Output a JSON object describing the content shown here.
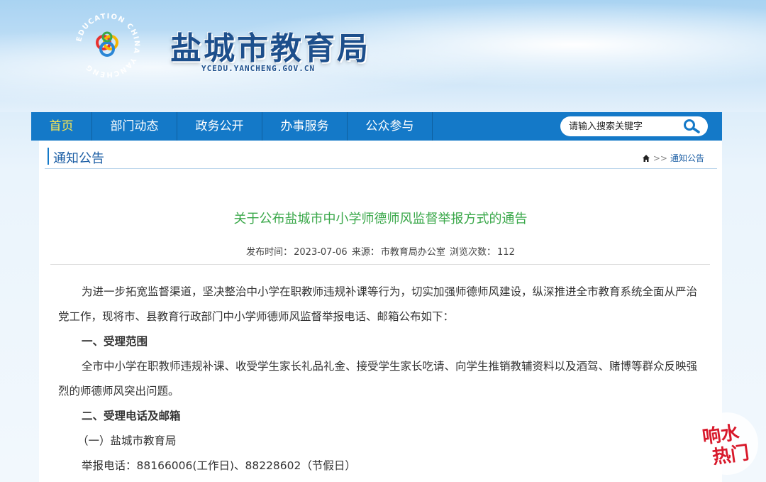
{
  "site": {
    "title": "盐城市教育局",
    "domain": "YCEDU.YANCHENG.GOV.CN",
    "logo_ring_text": "EDUCATION CHINA YANCHENG"
  },
  "nav": {
    "items": [
      "首页",
      "部门动态",
      "政务公开",
      "办事服务",
      "公众参与"
    ],
    "active_color": "#ffe94f",
    "bar_color": "#1479c8"
  },
  "search": {
    "placeholder": "请输入搜索关键字",
    "icon": "search-icon"
  },
  "section": {
    "title": "通知公告",
    "breadcrumb_sep": ">>",
    "breadcrumb_current": "通知公告",
    "home_icon": "home-icon"
  },
  "article": {
    "title": "关于公布盐城市中小学师德师风监督举报方式的通告",
    "meta": {
      "published_label": "发布时间：",
      "published": "2023-07-06",
      "source_label": "来源：",
      "source": "市教育局办公室",
      "views_label": "浏览次数：",
      "views": "112"
    },
    "paragraphs": [
      "为进一步拓宽监督渠道，坚决整治中小学在职教师违规补课等行为，切实加强师德师风建设，纵深推进全市教育系统全面从严治党工作，现将市、县教育行政部门中小学师德师风监督举报电话、邮箱公布如下：",
      "一、受理范围",
      "全市中小学在职教师违规补课、收受学生家长礼品礼金、接受学生家长吃请、向学生推销教辅资料以及酒驾、赌博等群众反映强烈的师德师风突出问题。",
      "二、受理电话及邮箱",
      "（一）盐城市教育局",
      "举报电话：88166006(工作日)、88228602（节假日）"
    ]
  },
  "watermark": {
    "text": [
      "响水",
      "热门"
    ],
    "color": "#d8192b"
  }
}
